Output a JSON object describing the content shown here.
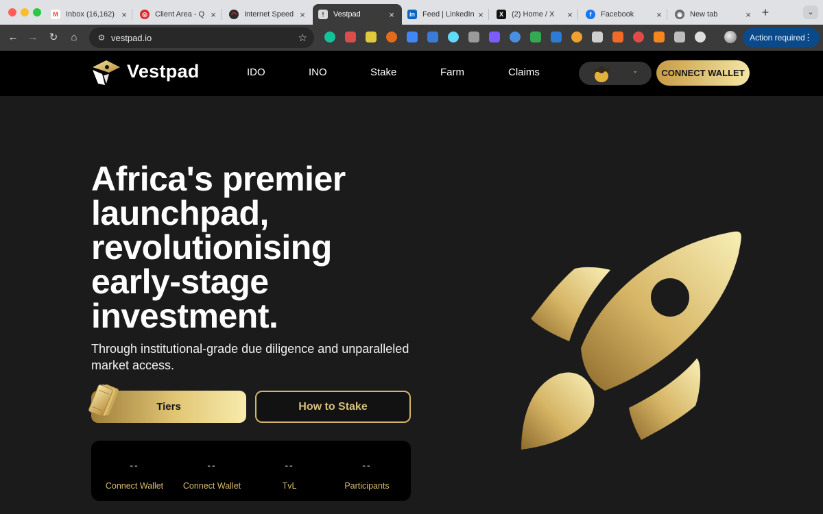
{
  "browser": {
    "tabs": [
      {
        "title": "Inbox (16,162)",
        "favicon": "gmail-icon",
        "color": "#ea4335",
        "glyph": "M"
      },
      {
        "title": "Client Area - Q",
        "favicon": "client-area-icon",
        "color": "#d62b2b",
        "glyph": "◎"
      },
      {
        "title": "Internet Speed",
        "favicon": "speedtest-icon",
        "color": "#c3242f",
        "glyph": "◠"
      },
      {
        "title": "Vestpad",
        "favicon": "vestpad-icon",
        "color": "#d9d9d9",
        "glyph": "!"
      },
      {
        "title": "Feed | LinkedIn",
        "favicon": "linkedin-icon",
        "color": "#0a66c2",
        "glyph": "in"
      },
      {
        "title": "(2) Home / X",
        "favicon": "x-icon",
        "color": "#111111",
        "glyph": "X"
      },
      {
        "title": "Facebook",
        "favicon": "facebook-icon",
        "color": "#1877f2",
        "glyph": "f"
      },
      {
        "title": "New tab",
        "favicon": "chrome-icon",
        "color": "#6b6b6b",
        "glyph": "◉"
      }
    ],
    "active_tab": 3,
    "url": "vestpad.io",
    "action_label": "Action required",
    "extensions": [
      {
        "name": "grammarly-extension-icon",
        "color": "#15c39a"
      },
      {
        "name": "key-extension-icon",
        "color": "#d94d4d"
      },
      {
        "name": "eyedropper-extension-icon",
        "color": "#e0c93a"
      },
      {
        "name": "basketball-extension-icon",
        "color": "#e26c1c"
      },
      {
        "name": "translate-extension-icon",
        "color": "#4285f4"
      },
      {
        "name": "feather-extension-icon",
        "color": "#3a7bd5"
      },
      {
        "name": "react-devtools-extension-icon",
        "color": "#61dafb"
      },
      {
        "name": "bug-extension-icon",
        "color": "#9a9a9a"
      },
      {
        "name": "brain-extension-icon",
        "color": "#7b5cff"
      },
      {
        "name": "docs-extension-icon",
        "color": "#4a90e2"
      },
      {
        "name": "diamond-extension-icon",
        "color": "#34a853"
      },
      {
        "name": "shield-extension-icon",
        "color": "#2e7bd6"
      },
      {
        "name": "pen-extension-icon",
        "color": "#f0a030"
      },
      {
        "name": "person-extension-icon",
        "color": "#cfcfcf"
      },
      {
        "name": "arrow-extension-icon",
        "color": "#f06a2a"
      },
      {
        "name": "ring-extension-icon",
        "color": "#e24a4a"
      },
      {
        "name": "metamask-extension-icon",
        "color": "#f6851b"
      },
      {
        "name": "record-extension-icon",
        "color": "#bdbdbd"
      },
      {
        "name": "puzzle-extension-icon",
        "color": "#dddddd"
      }
    ]
  },
  "site": {
    "brand": "Vestpad",
    "nav": [
      "IDO",
      "INO",
      "Stake",
      "Farm",
      "Claims"
    ],
    "connect_wallet": "CONNECT WALLET",
    "chain_caret": "⌄"
  },
  "hero": {
    "title_lines": [
      "Africa's premier",
      "launchpad,",
      "revolutionising",
      "early-stage",
      "investment."
    ],
    "subtitle": "Through institutional-grade due diligence and unparalleled market access.",
    "tiers_button": "Tiers",
    "stake_button": "How to Stake"
  },
  "stats": [
    {
      "value": "--",
      "label": "Connect Wallet"
    },
    {
      "value": "--",
      "label": "Connect Wallet"
    },
    {
      "value": "--",
      "label": "TvL"
    },
    {
      "value": "--",
      "label": "Participants"
    }
  ],
  "colors": {
    "accent_gold": "#d8b75b",
    "header_bg": "#000000",
    "page_bg": "#1b1b1b"
  }
}
